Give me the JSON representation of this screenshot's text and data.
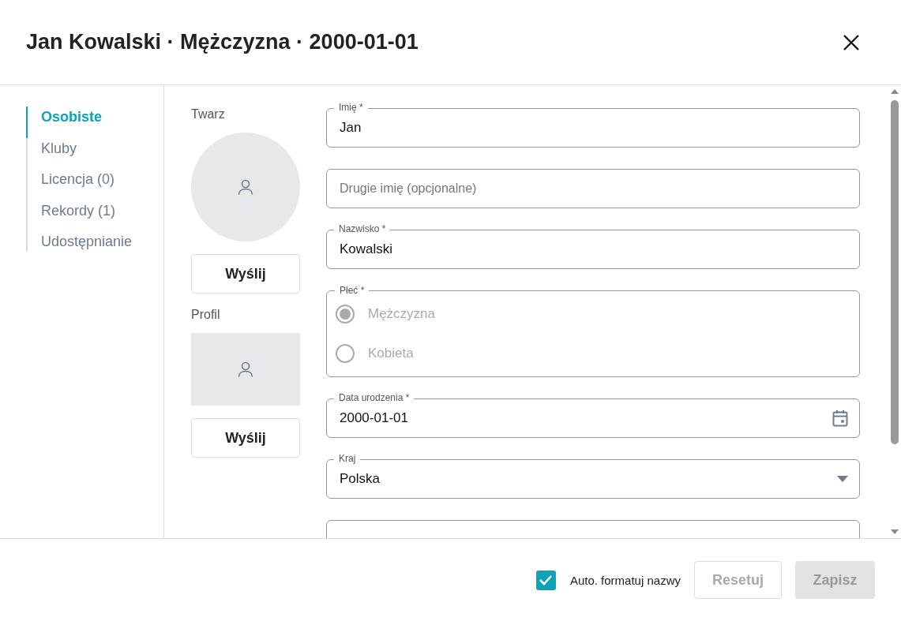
{
  "dialog": {
    "title": "Jan Kowalski · Mężczyzna · 2000-01-01"
  },
  "sidebar": {
    "items": [
      {
        "label": "Osobiste",
        "selected": true
      },
      {
        "label": "Kluby",
        "selected": false
      },
      {
        "label": "Licencja (0)",
        "selected": false
      },
      {
        "label": "Rekordy (1)",
        "selected": false
      },
      {
        "label": "Udostępnianie",
        "selected": false
      }
    ]
  },
  "photos": [
    {
      "label": "Twarz",
      "kind": "circle",
      "button": "Wyślij"
    },
    {
      "label": "Profil",
      "kind": "rect",
      "button": "Wyślij"
    }
  ],
  "fields": [
    {
      "kind": "text",
      "label": "Imię *",
      "value": "Jan"
    },
    {
      "kind": "text",
      "placeholder": "Drugie imię (opcjonalne)"
    },
    {
      "kind": "text",
      "label": "Nazwisko *",
      "value": "Kowalski"
    },
    {
      "kind": "radio",
      "label": "Płeć  *",
      "disabled": true,
      "options": [
        {
          "label": "Mężczyzna",
          "selected": true
        },
        {
          "label": "Kobieta",
          "selected": false
        }
      ]
    },
    {
      "kind": "date",
      "label": "Data urodzenia *",
      "value": "2000-01-01"
    },
    {
      "kind": "select",
      "label": "Kraj",
      "value": "Polska"
    },
    {
      "kind": "partial"
    }
  ],
  "footer": {
    "auto_format": {
      "label": "Auto. formatuj nazwy",
      "checked": true
    },
    "buttons": [
      {
        "label": "Resetuj",
        "kind": "outline",
        "disabled": true
      },
      {
        "label": "Zapisz",
        "kind": "filled",
        "disabled": true
      }
    ]
  }
}
